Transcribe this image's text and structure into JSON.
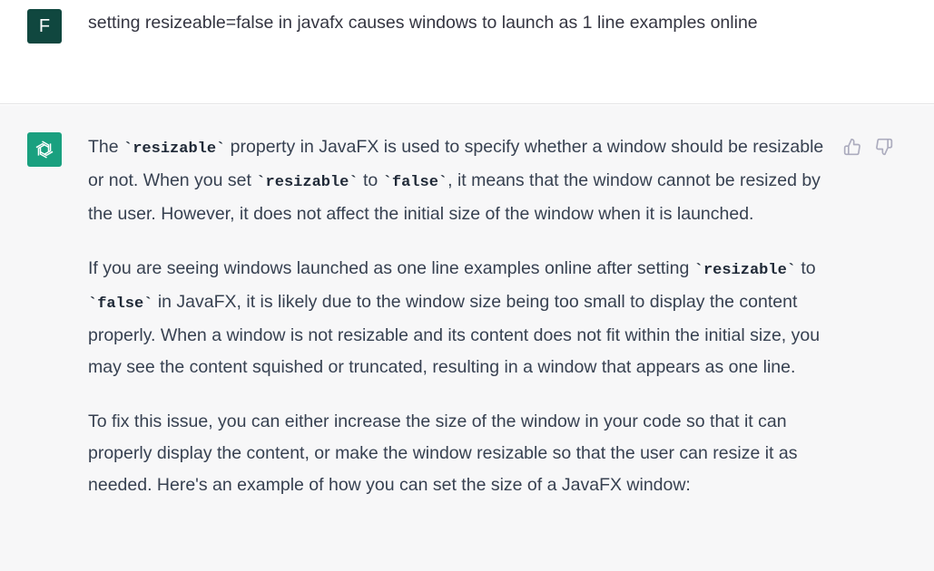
{
  "user_message": {
    "avatar_letter": "F",
    "text": "setting resizeable=false in javafx causes windows to launch as 1 line examples online"
  },
  "assistant_message": {
    "paragraphs": [
      {
        "a": "The ",
        "c1": "`resizable`",
        "b": " property in JavaFX is used to specify whether a window should be resizable or not. When you set ",
        "c2": "`resizable`",
        "d": " to ",
        "c3": "`false`",
        "e": ", it means that the window cannot be resized by the user. However, it does not affect the initial size of the window when it is launched."
      },
      {
        "a": "If you are seeing windows launched as one line examples online after setting ",
        "c1": "`resizable`",
        "b": " to ",
        "c2": "`false`",
        "d": " in JavaFX, it is likely due to the window size being too small to display the content properly. When a window is not resizable and its content does not fit within the initial size, you may see the content squished or truncated, resulting in a window that appears as one line."
      },
      {
        "text": "To fix this issue, you can either increase the size of the window in your code so that it can properly display the content, or make the window resizable so that the user can resize it as needed. Here's an example of how you can set the size of a JavaFX window:"
      }
    ]
  },
  "icons": {
    "thumbs_up": "thumbs-up-icon",
    "thumbs_down": "thumbs-down-icon",
    "assistant_logo": "openai-logo-icon"
  },
  "colors": {
    "user_avatar_bg": "#10473f",
    "assistant_avatar_bg": "#19a07f",
    "assistant_bg": "#f7f7f8"
  }
}
